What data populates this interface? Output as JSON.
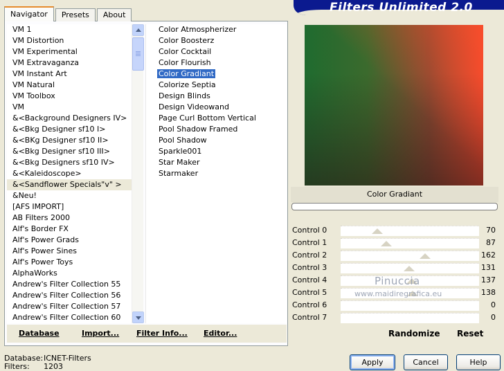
{
  "app": {
    "title": "Filters Unlimited 2.0"
  },
  "tabs": [
    "Navigator",
    "Presets",
    "About"
  ],
  "categories": [
    "VM 1",
    "VM Distortion",
    "VM Experimental",
    "VM Extravaganza",
    "VM Instant Art",
    "VM Natural",
    "VM Toolbox",
    "VM",
    "&<Background Designers IV>",
    "&<Bkg Designer sf10 I>",
    "&<BKg Designer sf10 II>",
    "&<Bkg Designer sf10 III>",
    "&<Bkg Designers sf10 IV>",
    "&<Kaleidoscope>",
    "&<Sandflower Specials\"v\" >",
    "&Neu!",
    "[AFS IMPORT]",
    "AB Filters 2000",
    "Alf's Border FX",
    "Alf's Power Grads",
    "Alf's Power Sines",
    "Alf's Power Toys",
    "AlphaWorks",
    "Andrew's Filter Collection 55",
    "Andrew's Filter Collection 56",
    "Andrew's Filter Collection 57",
    "Andrew's Filter Collection 60"
  ],
  "selected_category": "&<Sandflower Specials\"v\" >",
  "filters": [
    "Color Atmospherizer",
    "Color Boosterz",
    "Color Cocktail",
    "Color Flourish",
    "Color Gradiant",
    "Colorize Septia",
    "Design Blinds",
    "Design Videowand",
    "Page Curl Bottom Vertical",
    "Pool Shadow Framed",
    "Pool Shadow",
    "Sparkle001",
    "Star Maker",
    "Starmaker"
  ],
  "selected_filter": "Color Gradiant",
  "left_buttons": {
    "database": "Database",
    "import": "Import...",
    "filter_info": "Filter Info...",
    "editor": "Editor..."
  },
  "preview": {
    "filter_name": "Color Gradiant"
  },
  "controls": [
    {
      "label": "Control 0",
      "value": 70
    },
    {
      "label": "Control 1",
      "value": 87
    },
    {
      "label": "Control 2",
      "value": 162
    },
    {
      "label": "Control 3",
      "value": 131
    },
    {
      "label": "Control 4",
      "value": 137
    },
    {
      "label": "Control 5",
      "value": 138
    },
    {
      "label": "Control 6",
      "value": 0
    },
    {
      "label": "Control 7",
      "value": 0
    }
  ],
  "watermark": {
    "line1": "Pinuccia",
    "line2": "www.maidiregrafica.eu"
  },
  "right_buttons": {
    "randomize": "Randomize",
    "reset": "Reset"
  },
  "footer": {
    "database_label": "Database:",
    "database_value": "ICNET-Filters",
    "filters_label": "Filters:",
    "filters_value": "1203"
  },
  "dialog_buttons": {
    "apply": "Apply",
    "cancel": "Cancel",
    "help": "Help"
  },
  "colors": {
    "selection": "#316ac5",
    "banner": "#0b1a8f",
    "active_tab_accent": "#e68b2c"
  }
}
